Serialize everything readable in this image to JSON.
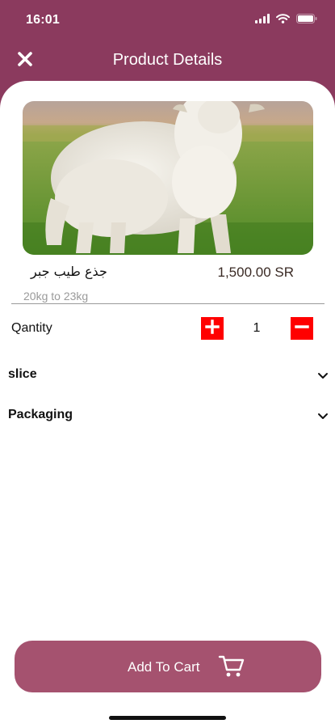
{
  "status_bar": {
    "time": "16:01"
  },
  "header": {
    "title": "Product Details"
  },
  "product": {
    "name": "جذع طيب جبر",
    "price": "1,500.00 SR",
    "weight": "20kg to 23kg"
  },
  "quantity": {
    "label": "Qantity",
    "value": "1"
  },
  "options": [
    {
      "label": "slice"
    },
    {
      "label": "Packaging"
    }
  ],
  "cart": {
    "label": "Add To Cart"
  },
  "colors": {
    "brand": "#8b3a5e",
    "cart_button": "#a5526f",
    "qty_button": "#ff0000"
  }
}
